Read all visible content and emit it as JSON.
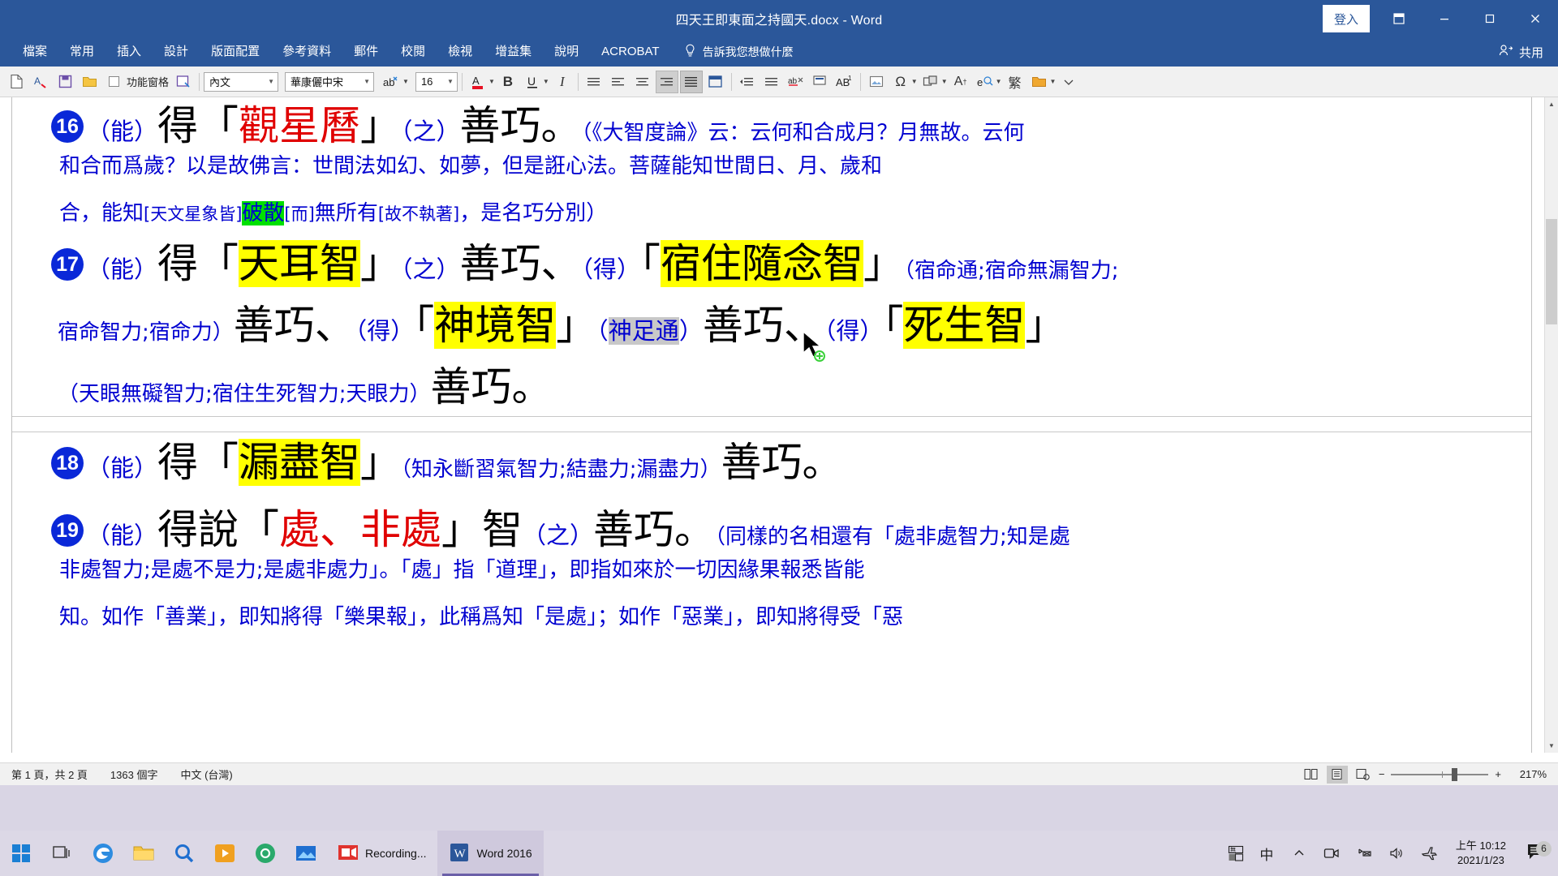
{
  "window": {
    "title": "四天王即東面之持國天.docx  -  Word",
    "signin_label": "登入",
    "restore_icon": "restore-window-icon",
    "minimize_icon": "minimize-icon",
    "maximize_icon": "maximize-icon",
    "close_icon": "close-icon"
  },
  "ribbon": {
    "tabs": [
      {
        "label": "檔案"
      },
      {
        "label": "常用"
      },
      {
        "label": "插入"
      },
      {
        "label": "設計"
      },
      {
        "label": "版面配置"
      },
      {
        "label": "參考資料"
      },
      {
        "label": "郵件"
      },
      {
        "label": "校閱"
      },
      {
        "label": "檢視"
      },
      {
        "label": "增益集"
      },
      {
        "label": "說明"
      },
      {
        "label": "ACROBAT"
      }
    ],
    "tell_me": "告訴我您想做什麼",
    "tell_me_icon": "lightbulb-icon",
    "share_label": "共用",
    "share_icon": "person-share-icon"
  },
  "toolbar": {
    "pane_label": "功能窗格",
    "style_value": "內文",
    "font_value": "華康儷中宋",
    "size_value": "16",
    "bold_label": "B",
    "underline_label": "U",
    "italic_label": "I",
    "highlight_color": "#16c60c",
    "font_color": "#e81123",
    "icons": [
      "new-document-icon",
      "format-painter-icon",
      "save-icon",
      "open-folder-icon",
      "checkbox-icon",
      "navigation-pane-icon",
      "highlighter-icon",
      "font-color-icon",
      "align-left-icon",
      "align-center-icon",
      "align-right-icon",
      "justify-icon",
      "distribute-icon",
      "page-border-icon",
      "line-spacing-icon",
      "paragraph-mark-icon",
      "phonetic-guide-icon",
      "photo-icon",
      "text-box-icon",
      "symbol-omega-icon",
      "shapes-icon",
      "text-effects-icon",
      "clear-formatting-icon",
      "traditional-chinese-icon",
      "folder-icon",
      "more-commands-icon"
    ]
  },
  "document": {
    "paragraphs": [
      {
        "number": "16",
        "lines": [
          [
            {
              "t": "（能）",
              "s": "sml blu"
            },
            {
              "t": "得「",
              "s": "big blk"
            },
            {
              "t": "觀星曆",
              "s": "big red"
            },
            {
              "t": "」",
              "s": "big blk"
            },
            {
              "t": "（之）",
              "s": "sml blu"
            },
            {
              "t": "善巧。",
              "s": "big blk"
            },
            {
              "t": "（《大智度論》云：云何和合成月？月無故。云何",
              "s": "tiny blu"
            }
          ],
          [
            {
              "t": "和合而爲歲？以是故佛言：世間法如幻、如夢，但是誑心法。菩薩能知世間日、月、歲和",
              "s": "tiny blu"
            }
          ],
          [
            {
              "t": "合，能知",
              "s": "tiny blu"
            },
            {
              "t": "[天文星象皆]",
              "s": "tiny blu small2"
            },
            {
              "t": "破散",
              "s": "tiny blu hl-g"
            },
            {
              "t": "[而]",
              "s": "tiny blu small2"
            },
            {
              "t": "無所有",
              "s": "tiny blu"
            },
            {
              "t": "[故不執著]",
              "s": "tiny blu small2"
            },
            {
              "t": "，是名巧分別）",
              "s": "tiny blu"
            }
          ]
        ]
      },
      {
        "number": "17",
        "lines": [
          [
            {
              "t": "（能）",
              "s": "sml blu"
            },
            {
              "t": "得「",
              "s": "big blk"
            },
            {
              "t": "天耳智",
              "s": "big blk hl-y"
            },
            {
              "t": "」",
              "s": "big blk"
            },
            {
              "t": "（之）",
              "s": "sml blu"
            },
            {
              "t": "善巧、",
              "s": "big blk"
            },
            {
              "t": "（得）",
              "s": "sml blu"
            },
            {
              "t": "「",
              "s": "big blk"
            },
            {
              "t": "宿住隨念智",
              "s": "big blk hl-y"
            },
            {
              "t": "」",
              "s": "big blk"
            },
            {
              "t": "（宿命通;宿命無漏智力;",
              "s": "tiny blu"
            }
          ],
          [
            {
              "t": "宿命智力;宿命力）",
              "s": "tiny blu"
            },
            {
              "t": "善巧、",
              "s": "big blk"
            },
            {
              "t": "（得）",
              "s": "sml blu"
            },
            {
              "t": "「",
              "s": "big blk"
            },
            {
              "t": "神境智",
              "s": "big blk hl-y"
            },
            {
              "t": "」",
              "s": "big blk"
            },
            {
              "t": "（",
              "s": "sml blu"
            },
            {
              "t": "神足通",
              "s": "sml blu hl-sel"
            },
            {
              "t": "）",
              "s": "sml blu"
            },
            {
              "t": "善巧、",
              "s": "big blk"
            },
            {
              "t": "（得）",
              "s": "sml blu"
            },
            {
              "t": "「",
              "s": "big blk"
            },
            {
              "t": "死生智",
              "s": "big blk hl-y"
            },
            {
              "t": "」",
              "s": "big blk"
            }
          ],
          [
            {
              "t": "（天眼無礙智力;宿住生死智力;天眼力）",
              "s": "tiny blu"
            },
            {
              "t": "善巧。",
              "s": "big blk"
            }
          ]
        ]
      },
      {
        "number": "18",
        "lines": [
          [
            {
              "t": "（能）",
              "s": "sml blu"
            },
            {
              "t": "得「",
              "s": "big blk"
            },
            {
              "t": "漏盡智",
              "s": "big blk hl-y"
            },
            {
              "t": "」",
              "s": "big blk"
            },
            {
              "t": "（知永斷習氣智力;結盡力;漏盡力）",
              "s": "tiny blu"
            },
            {
              "t": "善巧。",
              "s": "big blk"
            }
          ]
        ]
      },
      {
        "number": "19",
        "lines": [
          [
            {
              "t": "（能）",
              "s": "sml blu"
            },
            {
              "t": "得說「",
              "s": "big blk"
            },
            {
              "t": "處、非處",
              "s": "big red"
            },
            {
              "t": "」",
              "s": "big blk"
            },
            {
              "t": "智",
              "s": "big blk"
            },
            {
              "t": "（之）",
              "s": "sml blu"
            },
            {
              "t": "善巧。",
              "s": "big blk"
            },
            {
              "t": "（同樣的名相還有「處非處智力;知是處",
              "s": "tiny blu"
            }
          ],
          [
            {
              "t": "非處智力;是處不是力;是處非處力」。「處」指「道理」，即指如來於一切因緣果報悉皆能",
              "s": "tiny blu"
            }
          ],
          [
            {
              "t": "知。如作「善業」，即知將得「樂果報」，此稱爲知「是處」；如作「惡業」，即知將得受「惡",
              "s": "tiny blu"
            }
          ]
        ]
      }
    ]
  },
  "status": {
    "page_info": "第 1 頁，共 2 頁",
    "word_count": "1363 個字",
    "language": "中文 (台灣)",
    "zoom_level": "217%",
    "zoom_out_label": "−",
    "zoom_in_label": "+",
    "views": [
      "read-mode-icon",
      "print-layout-icon",
      "web-layout-icon"
    ]
  },
  "taskbar": {
    "start_icon": "windows-start-icon",
    "search_icon": "search-icon",
    "taskview_icon": "task-view-icon",
    "apps": [
      {
        "icon": "edge-icon",
        "label": ""
      },
      {
        "icon": "file-explorer-icon",
        "label": ""
      },
      {
        "icon": "search-magnifier-icon",
        "label": ""
      },
      {
        "icon": "potplayer-icon",
        "label": ""
      },
      {
        "icon": "app-green-icon",
        "label": ""
      },
      {
        "icon": "photos-icon",
        "label": ""
      }
    ],
    "tasks": [
      {
        "icon": "camtasia-recorder-icon",
        "label": "Recording...",
        "active": false
      },
      {
        "icon": "word-icon",
        "label": "Word 2016",
        "active": true
      }
    ],
    "tray": {
      "ime_mode": "中",
      "ime_pad_icon": "ime-pad-icon",
      "ime_half_icon": "ime-halfwidth-icon",
      "show_hidden_icon": "chevron-up-icon",
      "camera_icon": "camera-icon",
      "network_icon": "network-icon",
      "volume_icon": "volume-icon",
      "airplane_icon": "airplane-icon",
      "time": "上午 10:12",
      "date": "2021/1/23",
      "notification_icon": "notification-icon",
      "notification_count": "6"
    }
  }
}
